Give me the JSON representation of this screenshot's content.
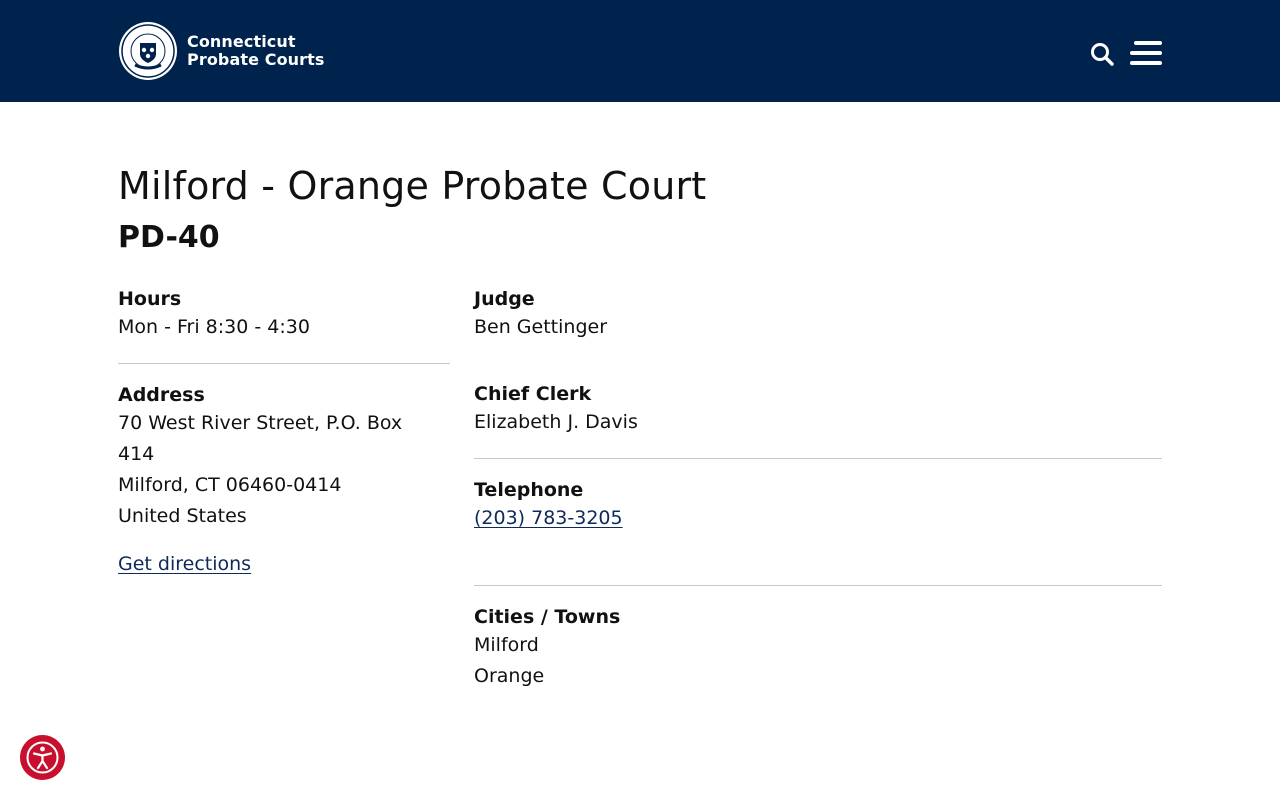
{
  "header": {
    "brand_line1": "Connecticut",
    "brand_line2": "Probate Courts",
    "search_icon": "search-icon",
    "menu_icon": "hamburger-menu-icon",
    "background_color": "#00234e"
  },
  "page": {
    "title": "Milford - Orange Probate Court",
    "district": "PD-40"
  },
  "hours": {
    "label": "Hours",
    "value": "Mon - Fri 8:30 - 4:30"
  },
  "address": {
    "label": "Address",
    "line1": "70 West River Street, P.O. Box",
    "line2": "414",
    "line3": "Milford, CT 06460-0414",
    "line4": "United States",
    "directions_link": "Get directions"
  },
  "judge": {
    "label": "Judge",
    "value": "Ben Gettinger"
  },
  "chief_clerk": {
    "label": "Chief Clerk",
    "value": "Elizabeth J. Davis"
  },
  "telephone": {
    "label": "Telephone",
    "value": "(203) 783-3205"
  },
  "towns": {
    "label": "Cities / Towns",
    "items": [
      "Milford",
      "Orange"
    ]
  },
  "accessibility": {
    "icon": "accessibility-icon",
    "color": "#c8102e"
  }
}
